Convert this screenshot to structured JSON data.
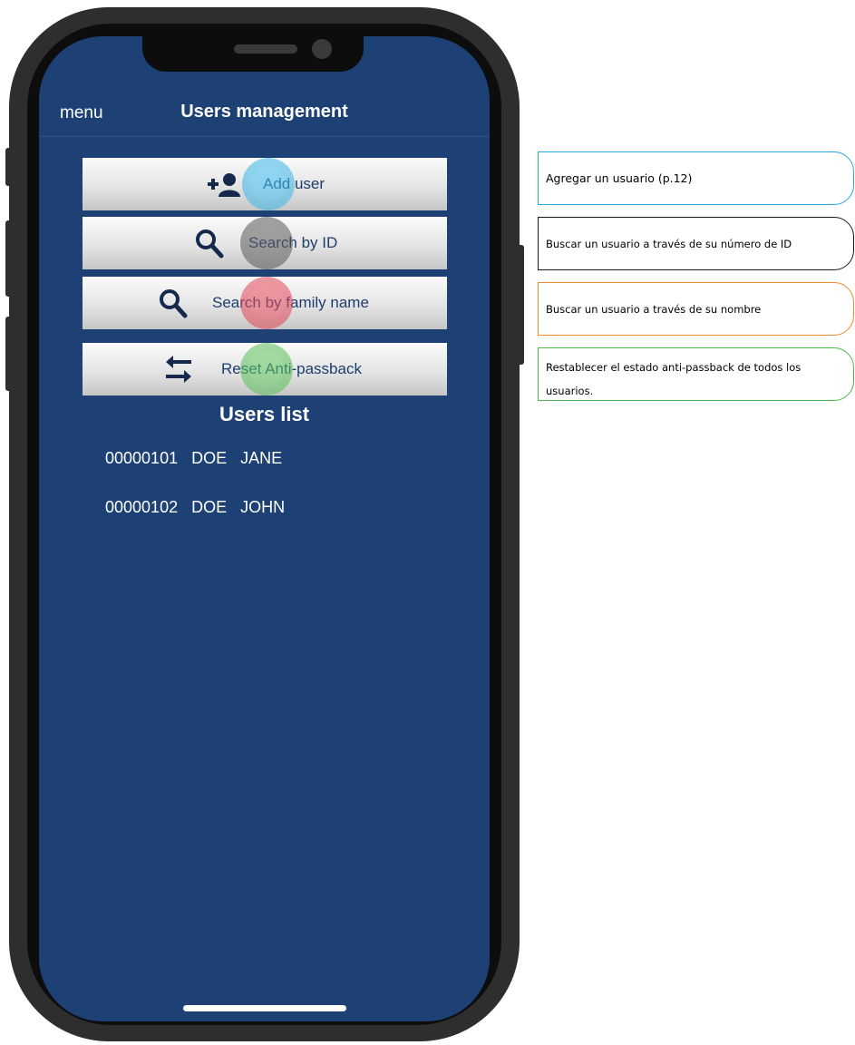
{
  "header": {
    "menu_label": "menu",
    "title": "Users management"
  },
  "actions": [
    {
      "label": "Add user",
      "icon": "add-user-icon",
      "highlight": "#3fb8e8"
    },
    {
      "label": "Search by ID",
      "icon": "search-icon",
      "highlight": "#5a5a5a"
    },
    {
      "label": "Search by family name",
      "icon": "search-icon",
      "highlight": "#e0495a"
    },
    {
      "label": "Reset Anti-passback",
      "icon": "swap-arrows-icon",
      "highlight": "#5cc15c"
    }
  ],
  "users_list": {
    "title": "Users list",
    "rows": [
      {
        "id": "00000101",
        "family_name": "DOE",
        "first_name": "JANE"
      },
      {
        "id": "00000102",
        "family_name": "DOE",
        "first_name": "JOHN"
      }
    ]
  },
  "callouts": [
    {
      "text": "Agregar un usuario (p.12)",
      "color": "#28a8e0"
    },
    {
      "text": "Buscar un usuario a través de su número de ID",
      "color": "#1a1a1a"
    },
    {
      "text": "Buscar un usuario a través de su nombre",
      "color": "#ef8a2e"
    },
    {
      "text": "Restablecer el estado anti-passback de todos los usuarios.",
      "color": "#4cb848"
    }
  ],
  "colors": {
    "screen_background": "#1d4174",
    "button_text": "#1d3e6d"
  }
}
